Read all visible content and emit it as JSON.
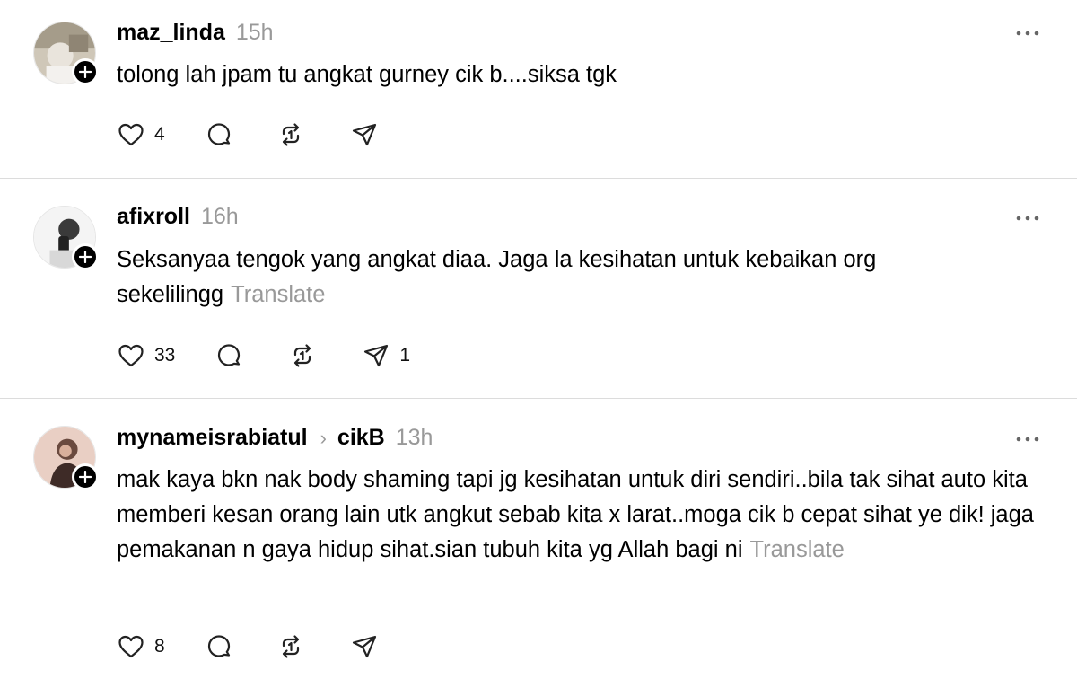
{
  "posts": [
    {
      "username": "maz_linda",
      "time": "15h",
      "text": "tolong lah jpam tu angkat gurney cik b....siksa tgk",
      "translate": "",
      "likes": "4",
      "shares": "",
      "avatar_icon": "person-photo"
    },
    {
      "username": "afixroll",
      "time": "16h",
      "text": "Seksanyaa tengok yang angkat diaa. Jaga la kesihatan untuk kebaikan org sekelilingg",
      "translate": "Translate",
      "likes": "33",
      "shares": "1",
      "avatar_icon": "person-photo"
    },
    {
      "username": "mynameisrabiatul",
      "reply_to": "cikB",
      "time": "13h",
      "text": "mak kaya bkn nak body shaming tapi jg kesihatan untuk diri sendiri..bila tak sihat auto kita memberi kesan orang lain utk angkut sebab kita x larat..moga cik b cepat sihat ye dik! jaga pemakanan n gaya hidup sihat.sian tubuh kita yg Allah bagi ni",
      "translate": "Translate",
      "likes": "8",
      "shares": "",
      "avatar_icon": "person-photo"
    }
  ],
  "icons": {
    "like": "heart-icon",
    "comment": "comment-icon",
    "repost": "repost-icon",
    "share": "send-icon",
    "more": "more-icon",
    "follow": "plus-icon"
  },
  "colors": {
    "text": "#000000",
    "muted": "#999999",
    "divider": "#dcdcdc"
  }
}
